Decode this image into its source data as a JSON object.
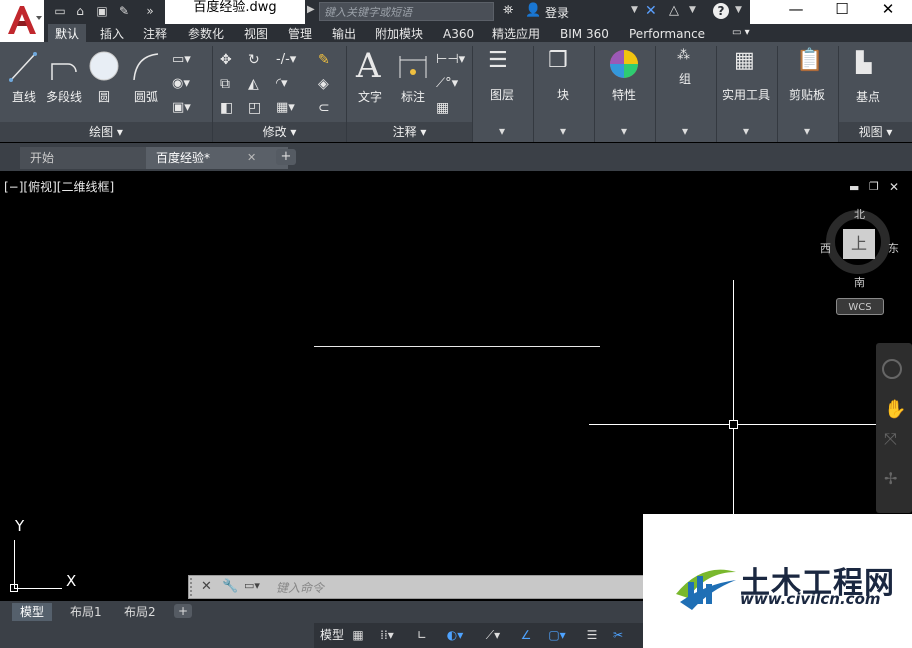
{
  "app": {
    "document_title": "百度经验.dwg",
    "search_placeholder": "键入关键字或短语",
    "login_label": "登录",
    "help_label": "?"
  },
  "window_controls": {
    "minimize": "—",
    "maximize": "☐",
    "close": "✕"
  },
  "ribbon_tabs": [
    "默认",
    "插入",
    "注释",
    "参数化",
    "视图",
    "管理",
    "输出",
    "附加模块",
    "A360",
    "精选应用",
    "BIM 360",
    "Performance"
  ],
  "draw_panel": {
    "tools": [
      "直线",
      "多段线",
      "圆",
      "圆弧"
    ],
    "title": "绘图 ▾"
  },
  "modify_panel": {
    "title": "修改 ▾"
  },
  "annotation_panel": {
    "tools": [
      "文字",
      "标注"
    ],
    "title": "注释 ▾"
  },
  "big_tools": [
    "图层",
    "块",
    "特性",
    "组",
    "实用工具",
    "剪贴板",
    "基点"
  ],
  "view_panel_title": "视图 ▾",
  "file_tabs": [
    "开始",
    "百度经验*"
  ],
  "viewport_label": "[−][俯视][二维线框]",
  "viewcube": {
    "north": "北",
    "south": "南",
    "east": "东",
    "west": "西",
    "top": "上",
    "wcs": "WCS"
  },
  "ucs": {
    "x": "X",
    "y": "Y"
  },
  "command_line": {
    "placeholder": "键入命令"
  },
  "layout_tabs": [
    "模型",
    "布局1",
    "布局2"
  ],
  "status": {
    "model": "模型"
  },
  "watermark": {
    "cn": "土木工程网",
    "url": "www.civilcn.com"
  },
  "colors": {
    "ribbon_bg": "#4a5058",
    "titlebar_dark": "#2b2f35",
    "canvas": "#000000",
    "accent_red": "#c1272d"
  }
}
